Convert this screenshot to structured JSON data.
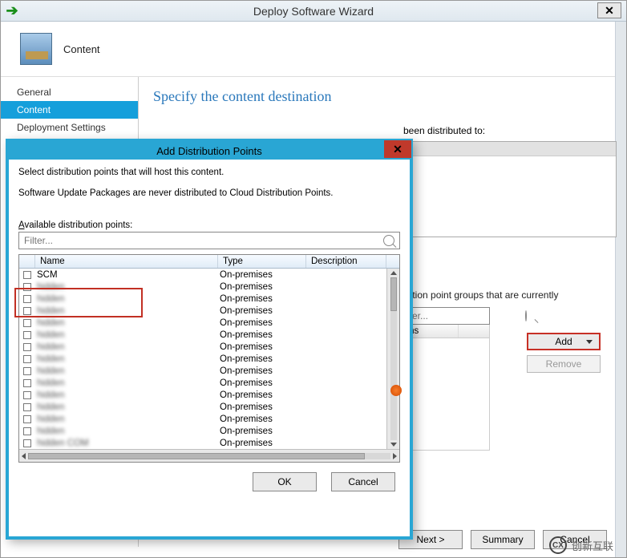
{
  "window_title": "Deploy Software Wizard",
  "header_label": "Content",
  "panel_heading": "Specify the content destination",
  "sidebar": {
    "items": [
      {
        "label": "General",
        "selected": false
      },
      {
        "label": "Content",
        "selected": true
      },
      {
        "label": "Deployment Settings",
        "selected": false
      }
    ]
  },
  "main": {
    "distributed_hint": "been distributed to:",
    "collections_hint": "tribution point groups that are currently",
    "filter_main_placeholder": "Filter...",
    "coll_col_1": "tions",
    "add_label": "Add",
    "remove_label": "Remove"
  },
  "footer": {
    "next_label": "Next >",
    "summary_label": "Summary",
    "cancel_label": "Cancel"
  },
  "dialog": {
    "title": "Add Distribution Points",
    "instruction1": "Select distribution points that will host this content.",
    "instruction2": "Software Update Packages are never distributed to Cloud Distribution Points.",
    "available_label_a": "A",
    "available_label_rest": "vailable distribution points:",
    "filter_placeholder": "Filter...",
    "columns": {
      "name": "Name",
      "type": "Type",
      "desc": "Description"
    },
    "rows": [
      {
        "name": "SCM",
        "type": "On-premises"
      },
      {
        "name": "hidden",
        "type": "On-premises"
      },
      {
        "name": "hidden",
        "type": "On-premises"
      },
      {
        "name": "hidden",
        "type": "On-premises"
      },
      {
        "name": "hidden",
        "type": "On-premises"
      },
      {
        "name": "hidden",
        "type": "On-premises"
      },
      {
        "name": "hidden",
        "type": "On-premises"
      },
      {
        "name": "hidden",
        "type": "On-premises"
      },
      {
        "name": "hidden",
        "type": "On-premises"
      },
      {
        "name": "hidden",
        "type": "On-premises"
      },
      {
        "name": "hidden",
        "type": "On-premises"
      },
      {
        "name": "hidden",
        "type": "On-premises"
      },
      {
        "name": "hidden",
        "type": "On-premises"
      },
      {
        "name": "hidden",
        "type": "On-premises"
      },
      {
        "name": "hidden COM",
        "type": "On-premises"
      }
    ],
    "ok_label": "OK",
    "cancel_label": "Cancel"
  },
  "watermark": "创新互联"
}
